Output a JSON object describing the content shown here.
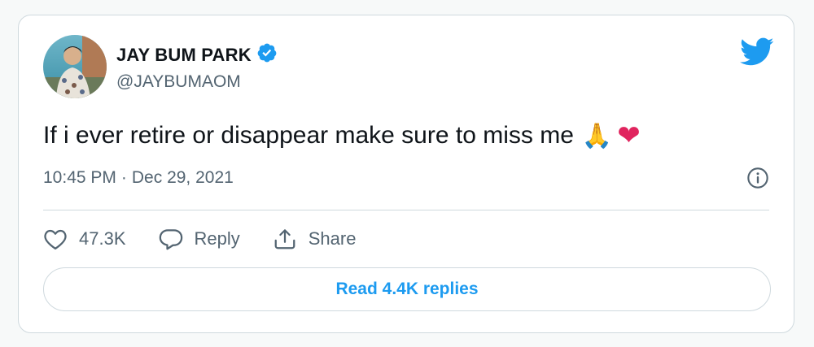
{
  "author": {
    "name": "JAY BUM PARK",
    "handle": "@JAYBUMAOM",
    "verified": true
  },
  "tweet": {
    "text": "If i ever retire or disappear make sure to miss me",
    "emojis": [
      "🙏",
      "❤"
    ],
    "time": "10:45 PM",
    "separator": "·",
    "date": "Dec 29, 2021"
  },
  "actions": {
    "likes": "47.3K",
    "reply_label": "Reply",
    "share_label": "Share"
  },
  "read_replies_label": "Read 4.4K replies",
  "colors": {
    "accent": "#1d9bf0",
    "heart": "#e0245e",
    "text_primary": "#0f1419",
    "text_secondary": "#536471",
    "border": "#cfd9de"
  },
  "icons": [
    "verified-badge-icon",
    "twitter-bird-icon",
    "info-icon",
    "heart-icon",
    "reply-icon",
    "share-icon"
  ]
}
